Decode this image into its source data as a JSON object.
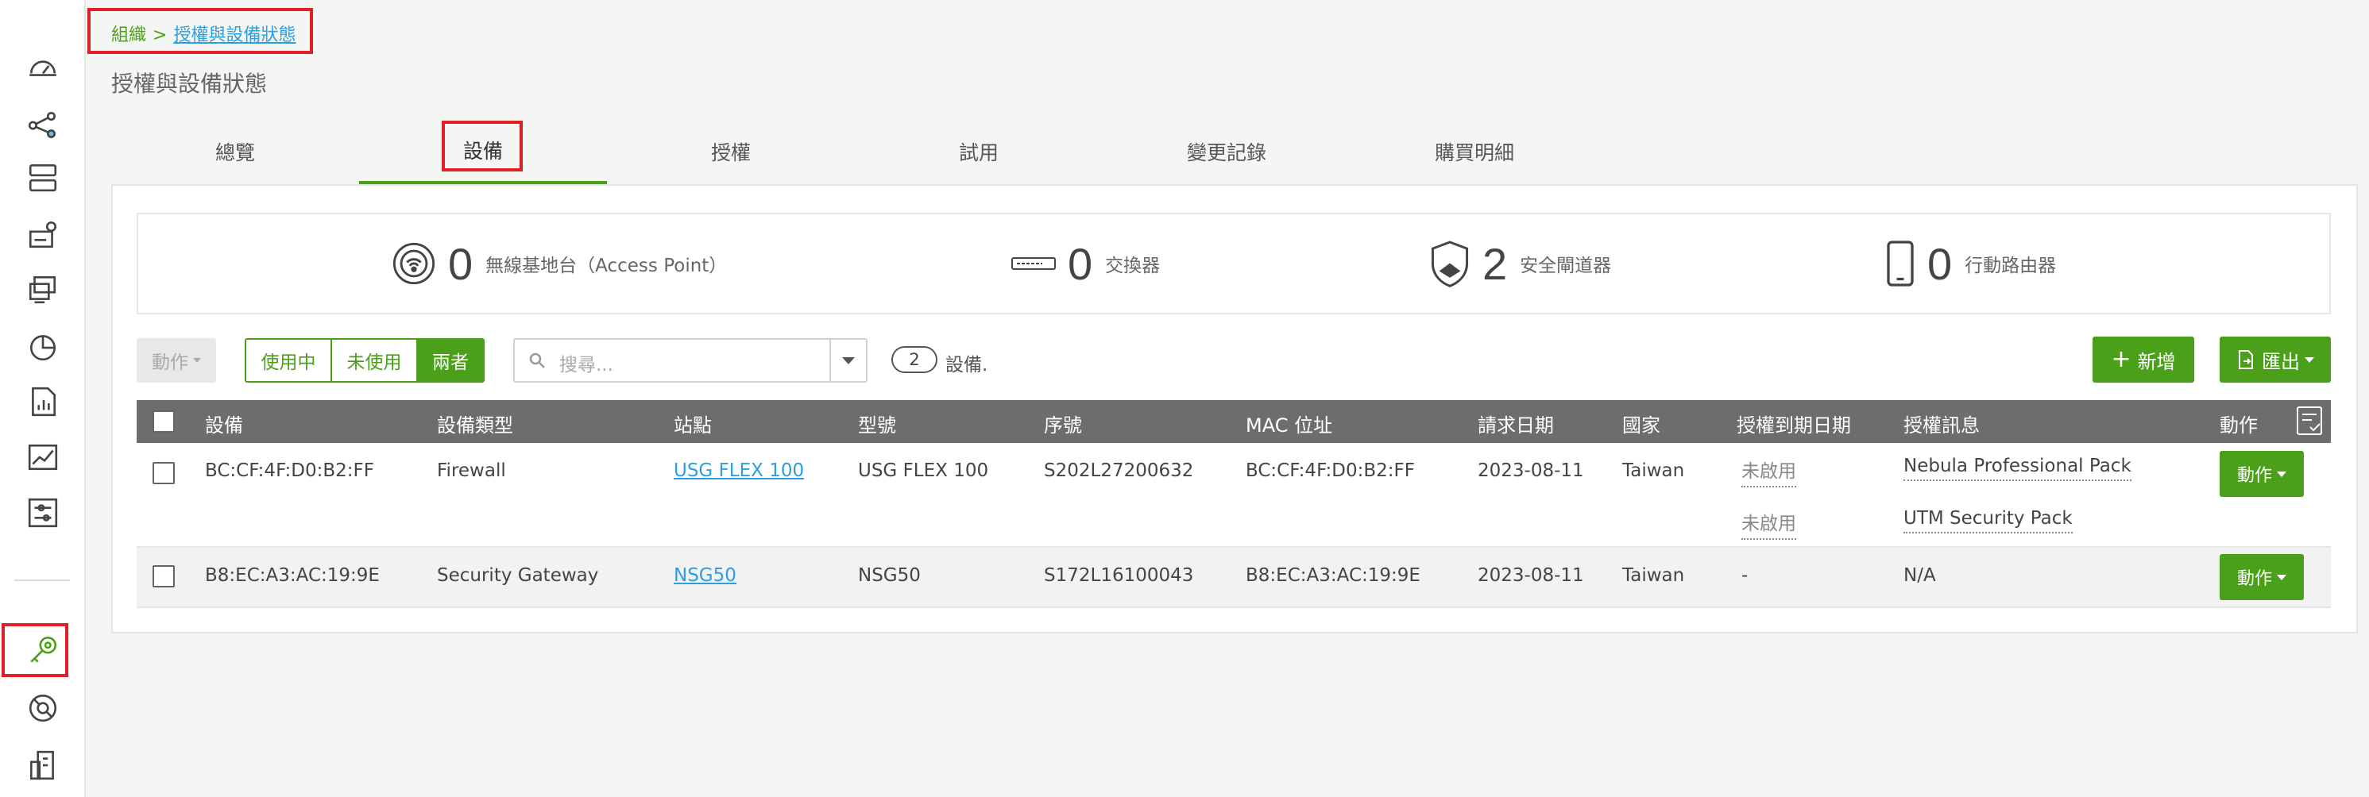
{
  "breadcrumb": {
    "parent": "組織",
    "separator": ">",
    "current": "授權與設備狀態"
  },
  "page_title": "授權與設備狀態",
  "tabs": [
    {
      "label": "總覽",
      "active": false
    },
    {
      "label": "設備",
      "active": true
    },
    {
      "label": "授權",
      "active": false
    },
    {
      "label": "試用",
      "active": false
    },
    {
      "label": "變更記錄",
      "active": false
    },
    {
      "label": "購買明細",
      "active": false
    }
  ],
  "summary": [
    {
      "icon": "access-point-icon",
      "count": "0",
      "label": "無線基地台（Access Point）"
    },
    {
      "icon": "switch-icon",
      "count": "0",
      "label": "交換器"
    },
    {
      "icon": "security-gateway-icon",
      "count": "2",
      "label": "安全閘道器"
    },
    {
      "icon": "mobile-router-icon",
      "count": "0",
      "label": "行動路由器"
    }
  ],
  "toolbar": {
    "action_label": "動作",
    "filter": [
      "使用中",
      "未使用",
      "兩者"
    ],
    "filter_selected": "兩者",
    "search_placeholder": "搜尋...",
    "device_count": "2",
    "device_count_suffix": "設備.",
    "add_label": "新增",
    "export_label": "匯出"
  },
  "table": {
    "headers": [
      "設備",
      "設備類型",
      "站點",
      "型號",
      "序號",
      "MAC 位址",
      "請求日期",
      "國家",
      "授權到期日期",
      "授權訊息",
      "動作"
    ],
    "rows": [
      {
        "device": "BC:CF:4F:D0:B2:FF",
        "type": "Firewall",
        "site": "USG FLEX 100",
        "model": "USG FLEX 100",
        "serial": "S202L27200632",
        "mac": "BC:CF:4F:D0:B2:FF",
        "date": "2023-08-11",
        "country": "Taiwan",
        "expiry": [
          "未啟用",
          "未啟用"
        ],
        "license": [
          "Nebula Professional Pack",
          "UTM Security Pack"
        ],
        "action": "動作"
      },
      {
        "device": "B8:EC:A3:AC:19:9E",
        "type": "Security Gateway",
        "site": "NSG50",
        "model": "NSG50",
        "serial": "S172L16100043",
        "mac": "B8:EC:A3:AC:19:9E",
        "date": "2023-08-11",
        "country": "Taiwan",
        "expiry": [
          "-"
        ],
        "license": [
          "N/A"
        ],
        "action": "動作"
      }
    ]
  },
  "colors": {
    "accent": "#4aa019",
    "link": "#2d9ee0",
    "highlight": "#e01f26",
    "header_bg": "#6d6d6d"
  }
}
